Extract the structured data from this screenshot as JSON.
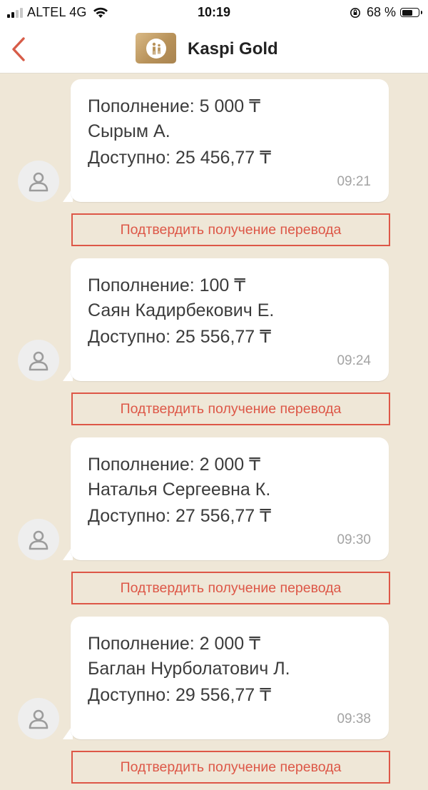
{
  "status_bar": {
    "carrier": "ALTEL 4G",
    "time": "10:19",
    "battery_percent": "68 %",
    "battery_level": 0.68
  },
  "header": {
    "title": "Kaspi Gold",
    "logo_icon": "kaspi-logo-icon",
    "back_icon": "chevron-left-icon",
    "accent_color": "#d75c48"
  },
  "messages": [
    {
      "line1": "Пополнение: 5 000 ₸",
      "line2": "Сырым  А.",
      "line3": "Доступно: 25 456,77 ₸",
      "time": "09:21",
      "button_label": "Подтвердить получение перевода"
    },
    {
      "line1": "Пополнение: 100 ₸",
      "line2": "Саян Кадирбекович Е.",
      "line3": "Доступно: 25 556,77 ₸",
      "time": "09:24",
      "button_label": "Подтвердить получение перевода"
    },
    {
      "line1": "Пополнение: 2 000 ₸",
      "line2": "Наталья Сергеевна К.",
      "line3": "Доступно: 27 556,77 ₸",
      "time": "09:30",
      "button_label": "Подтвердить получение перевода"
    },
    {
      "line1": "Пополнение: 2 000 ₸",
      "line2": "Баглан Нурболатович Л.",
      "line3": "Доступно: 29 556,77 ₸",
      "time": "09:38",
      "button_label": "Подтвердить получение перевода"
    }
  ],
  "colors": {
    "background": "#efe7d7",
    "bubble": "#ffffff",
    "button_border": "#dd5747",
    "time_text": "#a3a3a3"
  }
}
